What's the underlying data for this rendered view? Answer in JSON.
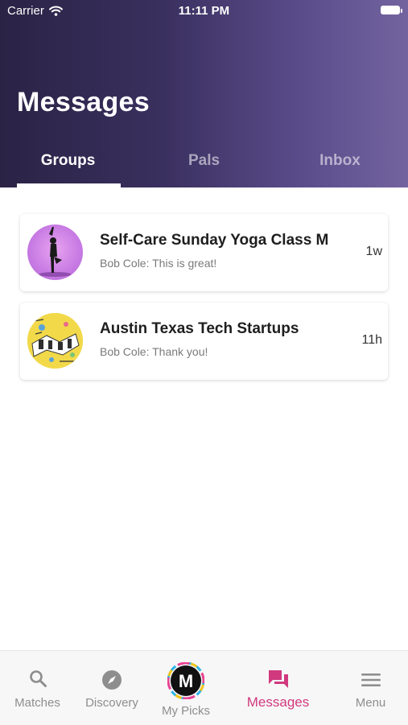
{
  "status_bar": {
    "carrier": "Carrier",
    "time": "11:11 PM"
  },
  "header": {
    "title": "Messages"
  },
  "tabs": [
    {
      "label": "Groups",
      "active": true
    },
    {
      "label": "Pals",
      "active": false
    },
    {
      "label": "Inbox",
      "active": false
    }
  ],
  "conversations": [
    {
      "title": "Self-Care Sunday Yoga Class M",
      "preview": "Bob Cole: This is great!",
      "time": "1w",
      "avatar_icon": "yoga-pose-icon"
    },
    {
      "title": "Austin Texas Tech Startups",
      "preview": "Bob Cole: Thank you!",
      "time": "11h",
      "avatar_icon": "tech-illustration-icon"
    }
  ],
  "tabbar": [
    {
      "label": "Matches",
      "icon": "search-icon",
      "active": false
    },
    {
      "label": "Discovery",
      "icon": "compass-icon",
      "active": false
    },
    {
      "label": "My Picks",
      "icon": "m-logo-icon",
      "logo_letter": "M",
      "active": false
    },
    {
      "label": "Messages",
      "icon": "chat-bubbles-icon",
      "active": true
    },
    {
      "label": "Menu",
      "icon": "hamburger-icon",
      "active": false
    }
  ],
  "colors": {
    "header_start": "#2a2345",
    "header_end": "#73649f",
    "accent": "#d1397e",
    "inactive": "#8e8e8e"
  }
}
